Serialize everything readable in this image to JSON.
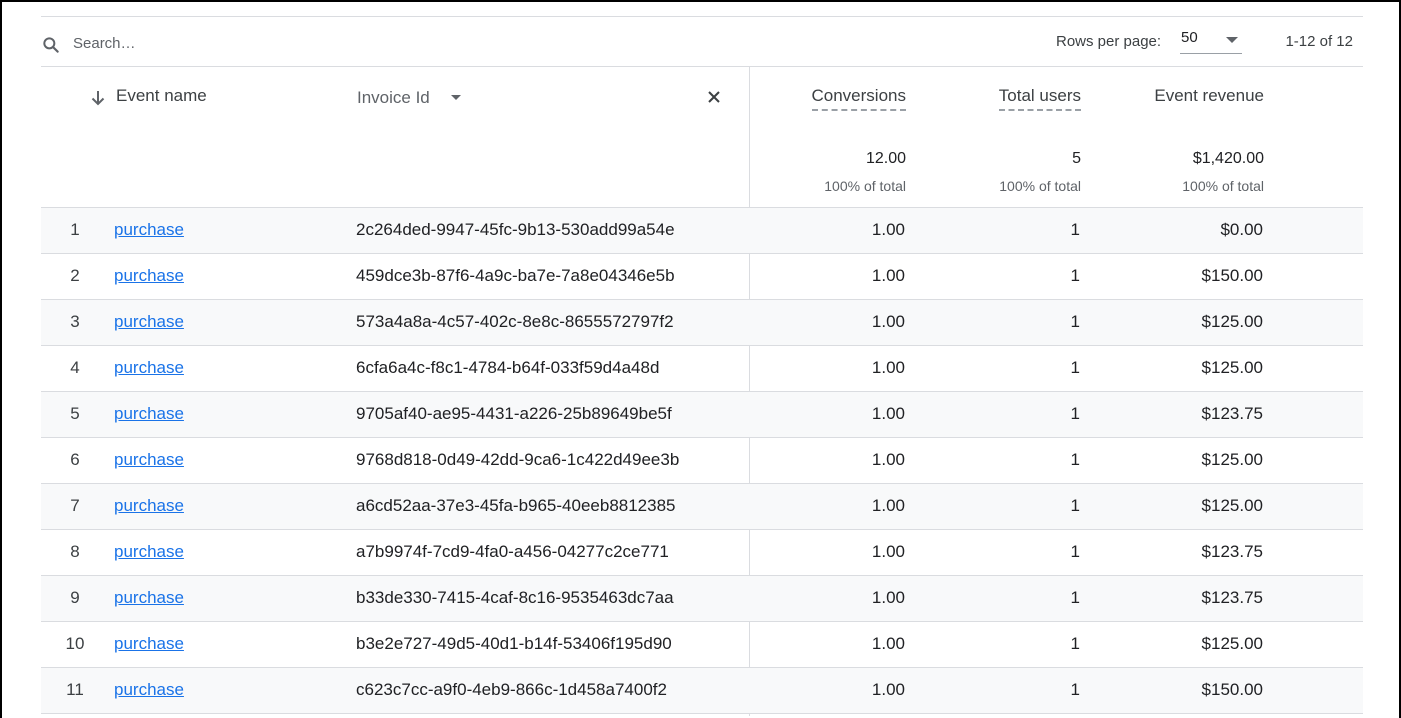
{
  "toolbar": {
    "search_placeholder": "Search…",
    "rows_per_page_label": "Rows per page:",
    "rows_per_page_value": "50",
    "range_text": "1-12 of 12"
  },
  "header": {
    "event_name": "Event name",
    "invoice_id": "Invoice Id",
    "conversions": "Conversions",
    "total_users": "Total users",
    "event_revenue": "Event revenue"
  },
  "totals": {
    "conversions": "12.00",
    "conversions_pct": "100% of total",
    "total_users": "5",
    "total_users_pct": "100% of total",
    "event_revenue": "$1,420.00",
    "event_revenue_pct": "100% of total"
  },
  "rows": [
    {
      "index": "1",
      "event": "purchase",
      "invoice": "2c264ded-9947-45fc-9b13-530add99a54e",
      "conversions": "1.00",
      "users": "1",
      "revenue": "$0.00"
    },
    {
      "index": "2",
      "event": "purchase",
      "invoice": "459dce3b-87f6-4a9c-ba7e-7a8e04346e5b",
      "conversions": "1.00",
      "users": "1",
      "revenue": "$150.00"
    },
    {
      "index": "3",
      "event": "purchase",
      "invoice": "573a4a8a-4c57-402c-8e8c-8655572797f2",
      "conversions": "1.00",
      "users": "1",
      "revenue": "$125.00"
    },
    {
      "index": "4",
      "event": "purchase",
      "invoice": "6cfa6a4c-f8c1-4784-b64f-033f59d4a48d",
      "conversions": "1.00",
      "users": "1",
      "revenue": "$125.00"
    },
    {
      "index": "5",
      "event": "purchase",
      "invoice": "9705af40-ae95-4431-a226-25b89649be5f",
      "conversions": "1.00",
      "users": "1",
      "revenue": "$123.75"
    },
    {
      "index": "6",
      "event": "purchase",
      "invoice": "9768d818-0d49-42dd-9ca6-1c422d49ee3b",
      "conversions": "1.00",
      "users": "1",
      "revenue": "$125.00"
    },
    {
      "index": "7",
      "event": "purchase",
      "invoice": "a6cd52aa-37e3-45fa-b965-40eeb8812385",
      "conversions": "1.00",
      "users": "1",
      "revenue": "$125.00"
    },
    {
      "index": "8",
      "event": "purchase",
      "invoice": "a7b9974f-7cd9-4fa0-a456-04277c2ce771",
      "conversions": "1.00",
      "users": "1",
      "revenue": "$123.75"
    },
    {
      "index": "9",
      "event": "purchase",
      "invoice": "b33de330-7415-4caf-8c16-9535463dc7aa",
      "conversions": "1.00",
      "users": "1",
      "revenue": "$123.75"
    },
    {
      "index": "10",
      "event": "purchase",
      "invoice": "b3e2e727-49d5-40d1-b14f-53406f195d90",
      "conversions": "1.00",
      "users": "1",
      "revenue": "$125.00"
    },
    {
      "index": "11",
      "event": "purchase",
      "invoice": "c623c7cc-a9f0-4eb9-866c-1d458a7400f2",
      "conversions": "1.00",
      "users": "1",
      "revenue": "$150.00"
    }
  ],
  "icons": {
    "search": "search-icon",
    "sort": "arrow-down-icon",
    "dropdown": "caret-down-icon",
    "close": "close-icon"
  },
  "colors": {
    "link": "#1a73e8",
    "row_stripe": "#f8f9fa",
    "divider": "#dadce0"
  }
}
